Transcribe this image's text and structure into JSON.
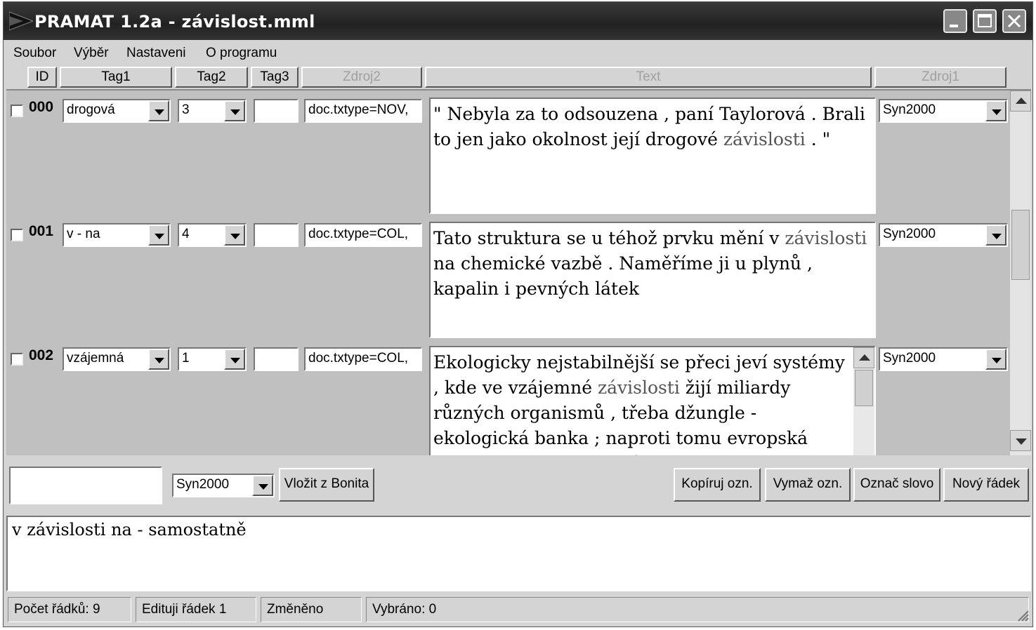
{
  "window": {
    "title": "PRAMAT 1.2a - závislost.mml"
  },
  "menu": [
    "Soubor",
    "Výběr",
    "Nastaveni",
    "O programu"
  ],
  "columns": [
    {
      "label": "ID",
      "enabled": true
    },
    {
      "label": "Tag1",
      "enabled": true
    },
    {
      "label": "Tag2",
      "enabled": true
    },
    {
      "label": "Tag3",
      "enabled": true
    },
    {
      "label": "Zdroj2",
      "enabled": false
    },
    {
      "label": "Text",
      "enabled": false
    },
    {
      "label": "Zdroj1",
      "enabled": false
    }
  ],
  "rows": [
    {
      "id": "000",
      "checked": false,
      "tag1": "drogová",
      "tag2": "3",
      "tag3": "",
      "zdroj2": "doc.txtype=NOV,",
      "text_before": "\" Nebyla za to odsouzena , paní Taylorová . Brali to jen jako okolnost její drogové ",
      "keyword": "závislosti",
      "text_after": " . \"",
      "zdroj1": "Syn2000"
    },
    {
      "id": "001",
      "checked": false,
      "tag1": "v - na",
      "tag2": "4",
      "tag3": "",
      "zdroj2": "doc.txtype=COL,",
      "text_before": "Tato struktura se u téhož prvku mění  v ",
      "keyword": "závislosti",
      "text_after": " na chemické  vazbě  . Naměříme ji u plynů , kapalin i pevných látek",
      "zdroj1": "Syn2000"
    },
    {
      "id": "002",
      "checked": false,
      "tag1": "vzájemná",
      "tag2": "1",
      "tag3": "",
      "zdroj2": "doc.txtype=COL,",
      "text_before": "Ekologicky nejstabilnější se přeci jeví systémy , kde ve vzájemné ",
      "keyword": "závislosti",
      "text_after": " žijí miliardy různých organismů , třeba džungle - ekologická banka ; naproti tomu evropská krajina typu ukrajinských",
      "zdroj1": "Syn2000"
    }
  ],
  "bottom": {
    "input_value": "",
    "source_select": "Syn2000",
    "insert_button": "Vložit z Bonita",
    "copy_button": "Kopíruj ozn.",
    "delete_button": "Vymaž ozn.",
    "mark_button": "Označ slovo",
    "newrow_button": "Nový řádek"
  },
  "memo": {
    "text": "v závislosti na - samostatně"
  },
  "status": {
    "row_count": "Počet řádků: 9",
    "editing": "Edituji řádek 1",
    "changed": "Změněno",
    "selected": "Vybráno: 0"
  }
}
